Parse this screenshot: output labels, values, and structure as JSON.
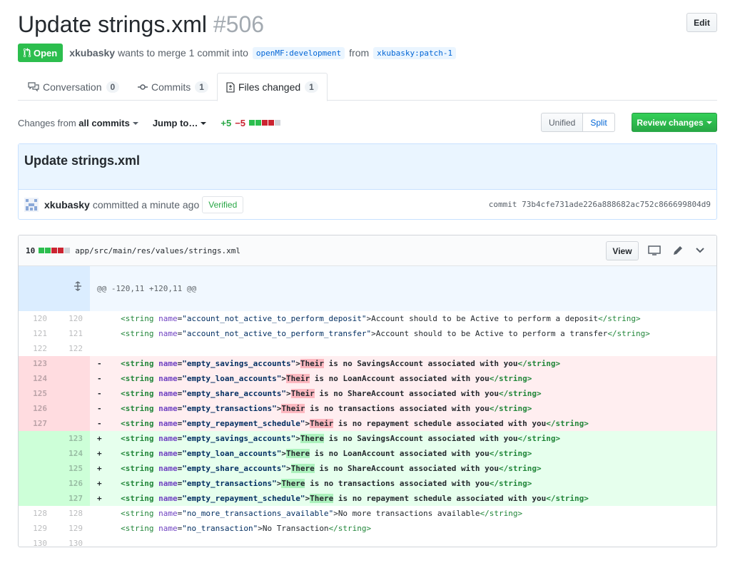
{
  "pr": {
    "title": "Update strings.xml",
    "number": "#506",
    "state": "Open",
    "author": "xkubasky",
    "merge_text": "wants to merge 1 commit into",
    "base_branch": "openMF:development",
    "from_text": "from",
    "head_branch": "xkubasky:patch-1",
    "edit_label": "Edit"
  },
  "tabs": [
    {
      "label": "Conversation",
      "count": "0"
    },
    {
      "label": "Commits",
      "count": "1"
    },
    {
      "label": "Files changed",
      "count": "1"
    }
  ],
  "toolbar": {
    "changes_from": "Changes from",
    "all_commits": "all commits",
    "jump_to": "Jump to…",
    "additions": "+5",
    "deletions": "−5",
    "unified": "Unified",
    "split": "Split",
    "review": "Review changes"
  },
  "commit": {
    "message": "Update strings.xml",
    "author": "xkubasky",
    "time": "committed a minute ago",
    "verified": "Verified",
    "sha_label": "commit 73b4cfe731ade226a888682ac752c866699804d9"
  },
  "file": {
    "change_count": "10",
    "path": "app/src/main/res/values/strings.xml",
    "view_label": "View",
    "hunk_header": "@@ -120,11 +120,11 @@",
    "lines": [
      {
        "type": "ctx",
        "old": "120",
        "new": "120",
        "sign": " ",
        "name": "account_not_active_to_perform_deposit",
        "pre": "",
        "hl": "",
        "post": "Account should to be Active to perform a deposit"
      },
      {
        "type": "ctx",
        "old": "121",
        "new": "121",
        "sign": " ",
        "name": "account_not_active_to_perform_transfer",
        "pre": "",
        "hl": "",
        "post": "Account should to be Active to perform a transfer"
      },
      {
        "type": "blank",
        "old": "122",
        "new": "122"
      },
      {
        "type": "del",
        "old": "123",
        "new": "",
        "sign": "-",
        "name": "empty_savings_accounts",
        "hl": "Their",
        "post": " is no SavingsAccount associated with you"
      },
      {
        "type": "del",
        "old": "124",
        "new": "",
        "sign": "-",
        "name": "empty_loan_accounts",
        "hl": "Their",
        "post": " is no LoanAccount associated with you"
      },
      {
        "type": "del",
        "old": "125",
        "new": "",
        "sign": "-",
        "name": "empty_share_accounts",
        "hl": "Their",
        "post": " is no ShareAccount associated with you"
      },
      {
        "type": "del",
        "old": "126",
        "new": "",
        "sign": "-",
        "name": "empty_transactions",
        "hl": "Their",
        "post": " is no transactions associated with you"
      },
      {
        "type": "del",
        "old": "127",
        "new": "",
        "sign": "-",
        "name": "empty_repayment_schedule",
        "hl": "Their",
        "post": " is no repayment schedule associated with you"
      },
      {
        "type": "add",
        "old": "",
        "new": "123",
        "sign": "+",
        "name": "empty_savings_accounts",
        "hl": "There",
        "post": " is no SavingsAccount associated with you"
      },
      {
        "type": "add",
        "old": "",
        "new": "124",
        "sign": "+",
        "name": "empty_loan_accounts",
        "hl": "There",
        "post": " is no LoanAccount associated with you"
      },
      {
        "type": "add",
        "old": "",
        "new": "125",
        "sign": "+",
        "name": "empty_share_accounts",
        "hl": "There",
        "post": " is no ShareAccount associated with you"
      },
      {
        "type": "add",
        "old": "",
        "new": "126",
        "sign": "+",
        "name": "empty_transactions",
        "hl": "There",
        "post": " is no transactions associated with you"
      },
      {
        "type": "add",
        "old": "",
        "new": "127",
        "sign": "+",
        "name": "empty_repayment_schedule",
        "hl": "There",
        "post": " is no repayment schedule associated with you"
      },
      {
        "type": "ctx",
        "old": "128",
        "new": "128",
        "sign": " ",
        "name": "no_more_transactions_available",
        "hl": "",
        "post": "No more transactions available"
      },
      {
        "type": "ctx",
        "old": "129",
        "new": "129",
        "sign": " ",
        "name": "no_transaction",
        "hl": "",
        "post": "No Transaction"
      },
      {
        "type": "blank",
        "old": "130",
        "new": "130"
      }
    ]
  },
  "colors": {
    "open_green": "#2cbe4e",
    "link_blue": "#0366d6",
    "deletion_bg": "#ffeef0",
    "addition_bg": "#e6ffed"
  }
}
